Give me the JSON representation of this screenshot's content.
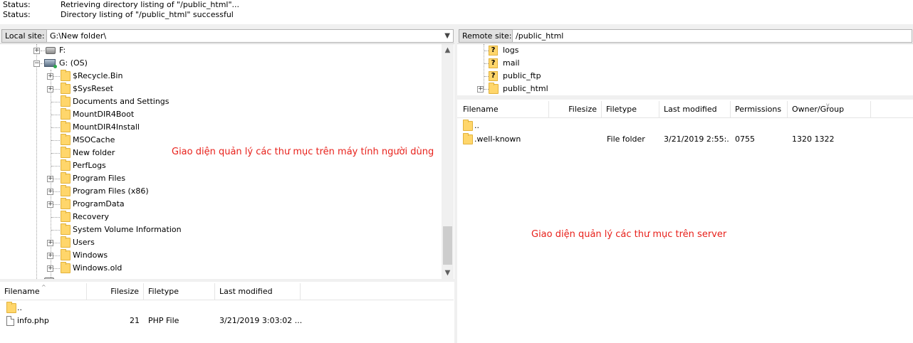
{
  "status_log": [
    {
      "label": "Status:",
      "message": "Retrieving directory listing of \"/public_html\"..."
    },
    {
      "label": "Status:",
      "message": "Directory listing of \"/public_html\" successful"
    }
  ],
  "local": {
    "site_label": "Local site:",
    "path": "G:\\New folder\\",
    "drives": [
      {
        "label": "F:"
      },
      {
        "label": "G: (OS)"
      }
    ],
    "tree_items": [
      {
        "label": "$Recycle.Bin",
        "expandable": true
      },
      {
        "label": "$SysReset",
        "expandable": true
      },
      {
        "label": "Documents and Settings",
        "expandable": false
      },
      {
        "label": "MountDIR4Boot",
        "expandable": false
      },
      {
        "label": "MountDIR4Install",
        "expandable": false
      },
      {
        "label": "MSOCache",
        "expandable": false
      },
      {
        "label": "New folder",
        "expandable": false
      },
      {
        "label": "PerfLogs",
        "expandable": false
      },
      {
        "label": "Program Files",
        "expandable": true
      },
      {
        "label": "Program Files (x86)",
        "expandable": true
      },
      {
        "label": "ProgramData",
        "expandable": true
      },
      {
        "label": "Recovery",
        "expandable": false
      },
      {
        "label": "System Volume Information",
        "expandable": false
      },
      {
        "label": "Users",
        "expandable": true
      },
      {
        "label": "Windows",
        "expandable": true
      },
      {
        "label": "Windows.old",
        "expandable": true
      }
    ],
    "annotation": "Giao diện quản lý các thư mục trên máy tính người dùng",
    "columns": [
      "Filename",
      "Filesize",
      "Filetype",
      "Last modified"
    ],
    "files": [
      {
        "name": "..",
        "size": "",
        "type": "",
        "modified": "",
        "icon": "folder-icon"
      },
      {
        "name": "info.php",
        "size": "21",
        "type": "PHP File",
        "modified": "3/21/2019 3:03:02 ...",
        "icon": "file-icon"
      }
    ]
  },
  "remote": {
    "site_label": "Remote site:",
    "path": "/public_html",
    "tree_items": [
      {
        "label": "logs",
        "icon": "unknown-folder-icon"
      },
      {
        "label": "mail",
        "icon": "unknown-folder-icon"
      },
      {
        "label": "public_ftp",
        "icon": "unknown-folder-icon"
      },
      {
        "label": "public_html",
        "icon": "folder-icon"
      }
    ],
    "unknown_marker": "?",
    "annotation": "Giao diện quản lý các thư mục trên server",
    "columns": [
      "Filename",
      "Filesize",
      "Filetype",
      "Last modified",
      "Permissions",
      "Owner/Group"
    ],
    "files": [
      {
        "name": "..",
        "size": "",
        "type": "",
        "modified": "",
        "perms": "",
        "owner": ""
      },
      {
        "name": ".well-known",
        "size": "",
        "type": "File folder",
        "modified": "3/21/2019 2:55:...",
        "perms": "0755",
        "owner": "1320 1322"
      }
    ]
  },
  "icons": {
    "expand": "+",
    "collapse": "−",
    "scroll_up": "▲",
    "scroll_down": "▼",
    "dropdown": "▼",
    "sort_up": "^",
    "sort_down": "v"
  },
  "colors": {
    "annotation": "#e8211b",
    "folder": "#ffd66b",
    "panel_bg": "#f0f0f0"
  }
}
